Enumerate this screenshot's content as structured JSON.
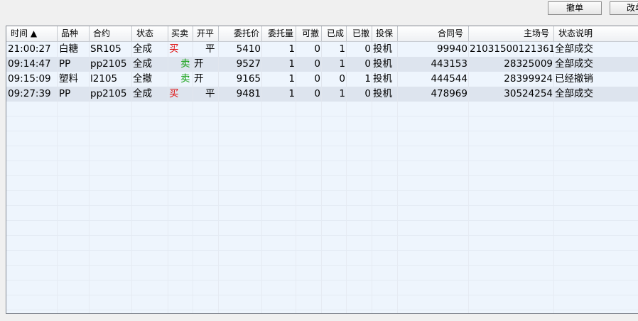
{
  "toolbar": {
    "cancel_label": "撤单",
    "modify_label": "改单"
  },
  "columns": [
    "时间 ▲",
    "品种",
    "合约",
    "状态",
    "买卖",
    "开平",
    "委托价",
    "委托量",
    "可撤",
    "已成",
    "已撤",
    "投保",
    "合同号",
    "主场号",
    "状态说明"
  ],
  "rows": [
    {
      "time": "21:00:27",
      "product": "白糖",
      "contract": "SR105",
      "status": "全成",
      "side": "买",
      "side_type": "buy",
      "offset": "平",
      "price": "5410",
      "qty": "1",
      "cancellable": "0",
      "filled": "1",
      "cancelled": "0",
      "hedge": "投机",
      "contract_no": "99940",
      "exchange_no": "210315001213­61",
      "desc": "全部成交"
    },
    {
      "time": "09:14:47",
      "product": "PP",
      "contract": "pp2105",
      "status": "全成",
      "side": "卖",
      "side_type": "sell",
      "offset": "开",
      "price": "9527",
      "qty": "1",
      "cancellable": "0",
      "filled": "1",
      "cancelled": "0",
      "hedge": "投机",
      "contract_no": "443153",
      "exchange_no": "28325009",
      "desc": "全部成交"
    },
    {
      "time": "09:15:09",
      "product": "塑料",
      "contract": "l2105",
      "status": "全撤",
      "side": "卖",
      "side_type": "sell",
      "offset": "开",
      "price": "9165",
      "qty": "1",
      "cancellable": "0",
      "filled": "0",
      "cancelled": "1",
      "hedge": "投机",
      "contract_no": "444544",
      "exchange_no": "28399924",
      "desc": "已经撤销"
    },
    {
      "time": "09:27:39",
      "product": "PP",
      "contract": "pp2105",
      "status": "全成",
      "side": "买",
      "side_type": "buy",
      "offset": "平",
      "price": "9481",
      "qty": "1",
      "cancellable": "0",
      "filled": "1",
      "cancelled": "0",
      "hedge": "投机",
      "contract_no": "478969",
      "exchange_no": "30524254",
      "desc": "全部成交"
    }
  ],
  "colors": {
    "buy": "#e01010",
    "sell": "#14a014",
    "row_alt": "#dde4ee",
    "grid_bg": "#eef5fd"
  }
}
